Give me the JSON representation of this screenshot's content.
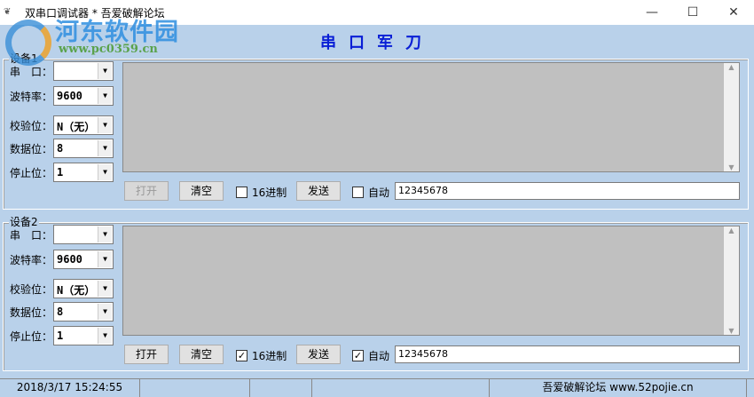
{
  "window": {
    "title": "双串口调试器   * 吾爱破解论坛",
    "minimize": "—",
    "maximize": "☐",
    "close": "✕"
  },
  "watermark": {
    "name": "河东软件园",
    "url": "www.pc0359.cn"
  },
  "banner": "串口军刀",
  "groups": [
    {
      "label": "设备1",
      "port_label": "串　口：",
      "port_value": "",
      "baud_label": "波特率：",
      "baud_value": "9600",
      "parity_label": "校验位：",
      "parity_value": "N（无）",
      "data_label": "数据位：",
      "data_value": "8",
      "stop_label": "停止位：",
      "stop_value": "1",
      "open": "打开",
      "open_disabled": true,
      "clear": "清空",
      "hex_label": "16进制",
      "hex_checked": false,
      "send": "发送",
      "auto_label": "自动",
      "auto_checked": false,
      "send_text": "12345678"
    },
    {
      "label": "设备2",
      "port_label": "串　口：",
      "port_value": "",
      "baud_label": "波特率：",
      "baud_value": "9600",
      "parity_label": "校验位：",
      "parity_value": "N（无）",
      "data_label": "数据位：",
      "data_value": "8",
      "stop_label": "停止位：",
      "stop_value": "1",
      "open": "打开",
      "open_disabled": false,
      "clear": "清空",
      "hex_label": "16进制",
      "hex_checked": true,
      "send": "发送",
      "auto_label": "自动",
      "auto_checked": true,
      "send_text": "12345678"
    }
  ],
  "status": {
    "datetime": "2018/3/17 15:24:55",
    "panel2": "",
    "panel3": "",
    "credit": "吾爱破解论坛 www.52pojie.cn"
  }
}
